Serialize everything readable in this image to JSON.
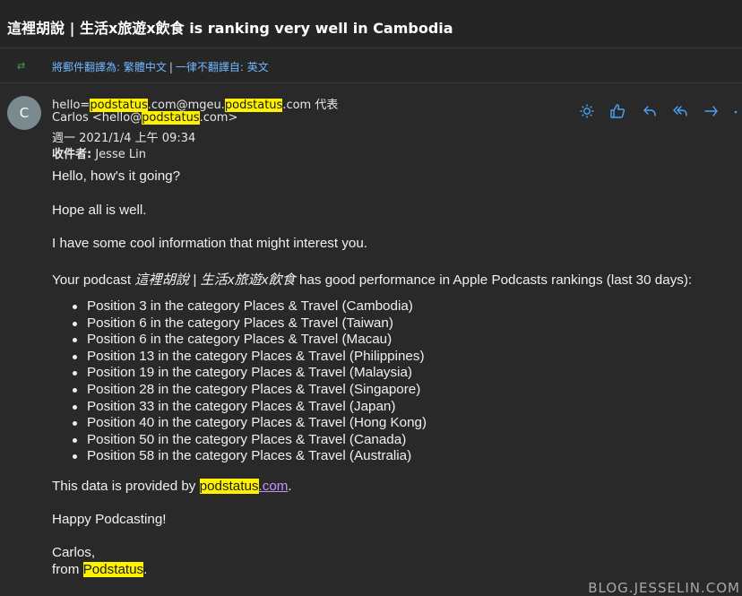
{
  "title": "這裡胡說 | 生活x旅遊x飲食 is ranking very well in Cambodia",
  "translate": {
    "prefix": "將郵件翻譯為: ",
    "target_lang": "繁體中文",
    "separator": "|",
    "never_prefix": "一律不翻譯自: ",
    "source_lang": "英文"
  },
  "avatar_letter": "C",
  "header": {
    "sender_prefix": "hello=",
    "sender_hl1": "podstatus",
    "sender_mid": ".com@mgeu.",
    "sender_hl2": "podstatus",
    "sender_suffix": ".com 代表",
    "from_prefix": "Carlos <hello@",
    "from_hl": "podstatus",
    "from_suffix": ".com>",
    "date": "週一 2021/1/4 上午 09:34",
    "to_label": "收件者:",
    "to_name": " Jesse Lin"
  },
  "body": {
    "greeting": "Hello, how's it going?",
    "hope": "Hope all is well.",
    "info": "I have some cool information that might interest you.",
    "perf_prefix": "Your podcast ",
    "perf_podcast": "這裡胡說 | 生活x旅遊x飲食",
    "perf_suffix": " has good performance in Apple Podcasts rankings (last 30 days):",
    "rankings": [
      "Position 3 in the category Places & Travel (Cambodia)",
      "Position 6 in the category Places & Travel (Taiwan)",
      "Position 6 in the category Places & Travel (Macau)",
      "Position 13 in the category Places & Travel (Philippines)",
      "Position 19 in the category Places & Travel (Malaysia)",
      "Position 28 in the category Places & Travel (Singapore)",
      "Position 33 in the category Places & Travel (Japan)",
      "Position 40 in the category Places & Travel (Hong Kong)",
      "Position 50 in the category Places & Travel (Canada)",
      "Position 58 in the category Places & Travel (Australia)"
    ],
    "provided_prefix": "This data is provided by ",
    "provided_hl": "podstatus",
    "provided_link": ".com",
    "provided_suffix": ".",
    "happy": "Happy Podcasting!",
    "sign_name": "Carlos,",
    "sign_from": "from ",
    "sign_hl": "Podstatus",
    "sign_suffix": "."
  },
  "actions": [
    {
      "name": "sun-icon"
    },
    {
      "name": "thumbs-up-icon"
    },
    {
      "name": "reply-icon"
    },
    {
      "name": "reply-all-icon"
    },
    {
      "name": "forward-icon"
    },
    {
      "name": "more-icon"
    }
  ],
  "watermark": "BLOG.JESSELIN.COM",
  "colors": {
    "background": "#292929",
    "highlight": "#fff200",
    "accent": "#4aa3ff",
    "link": "#c893ff"
  }
}
